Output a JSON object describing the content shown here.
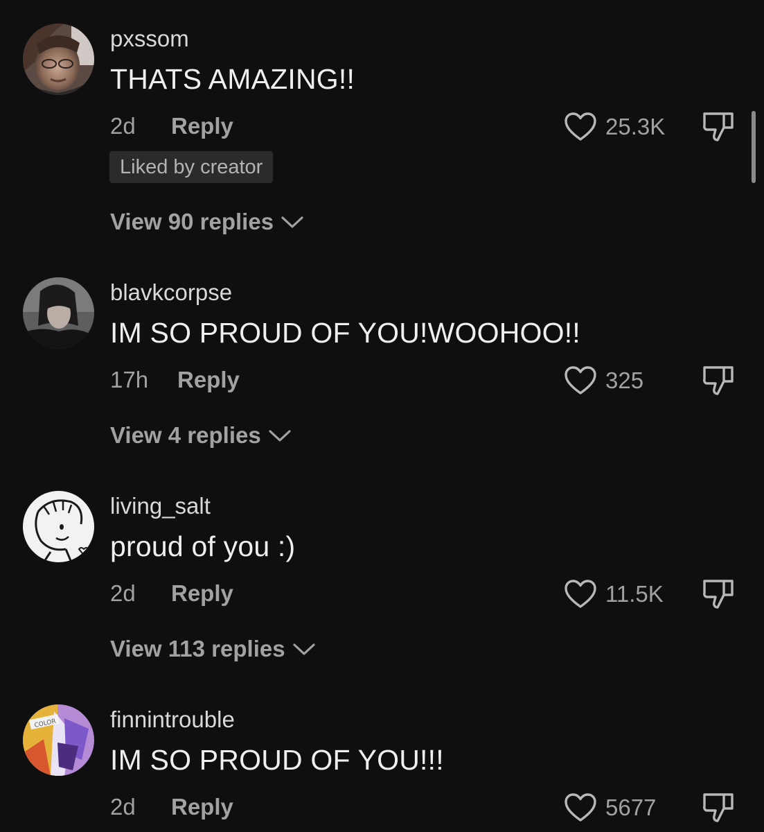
{
  "comments": [
    {
      "username": "pxssom",
      "text": "THATS AMAZING!!",
      "time": "2d",
      "reply_label": "Reply",
      "likes": "25.3K",
      "badge": "Liked by creator",
      "view_replies": "View 90 replies",
      "avatar_icon": "user-avatar-photo"
    },
    {
      "username": "blavkcorpse",
      "text": "IM SO PROUD OF YOU!WOOHOO!!",
      "time": "17h",
      "reply_label": "Reply",
      "likes": "325",
      "view_replies": "View 4 replies",
      "avatar_icon": "user-avatar-photo"
    },
    {
      "username": "living_salt",
      "text": "proud of you :)",
      "time": "2d",
      "reply_label": "Reply",
      "likes": "11.5K",
      "view_replies": "View 113 replies",
      "avatar_icon": "user-avatar-sketch"
    },
    {
      "username": "finnintrouble",
      "text": "IM SO PROUD OF YOU!!!",
      "time": "2d",
      "reply_label": "Reply",
      "likes": "5677",
      "avatar_icon": "user-avatar-art",
      "avatar_text": "COLOR"
    }
  ],
  "icons": {
    "like": "heart-outline-icon",
    "dislike": "thumbs-down-icon",
    "expand": "chevron-down-icon"
  },
  "colors": {
    "background": "#0f0f0f",
    "primary_text": "#efefef",
    "secondary_text": "#a2a2a2",
    "badge_bg": "#2b2b2b"
  }
}
